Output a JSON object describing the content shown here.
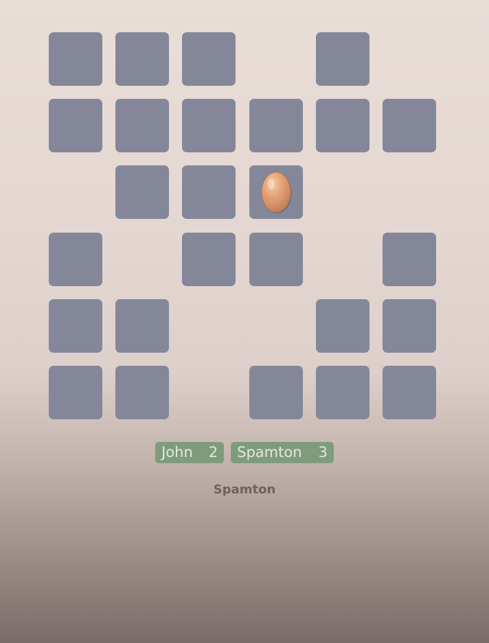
{
  "board": {
    "rows": [
      [
        "tile",
        "tile",
        "tile",
        "empty",
        "tile",
        "empty"
      ],
      [
        "tile",
        "tile",
        "tile",
        "tile",
        "tile",
        "tile"
      ],
      [
        "empty",
        "tile",
        "tile",
        "egg",
        "empty",
        "empty"
      ],
      [
        "tile",
        "empty",
        "tile",
        "tile",
        "empty",
        "tile"
      ],
      [
        "tile",
        "tile",
        "empty",
        "empty",
        "tile",
        "tile"
      ],
      [
        "tile",
        "tile",
        "empty",
        "tile",
        "tile",
        "tile"
      ]
    ]
  },
  "players": [
    {
      "name": "John",
      "score": "2"
    },
    {
      "name": "Spamton",
      "score": "3"
    }
  ],
  "current_turn": "Spamton",
  "colors": {
    "tile": "#838799",
    "score_badge": "#7e9c7c",
    "egg": "#e2a277"
  },
  "icons": {
    "egg": "egg-icon"
  }
}
